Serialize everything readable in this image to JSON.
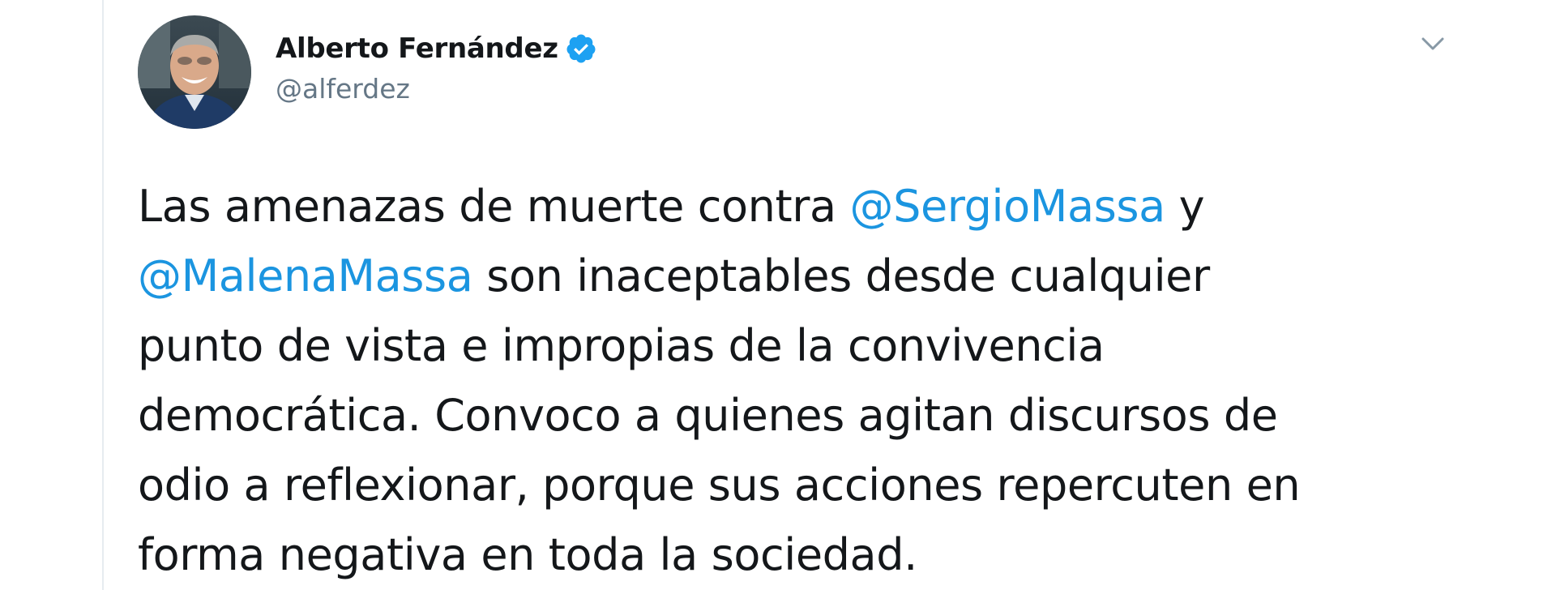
{
  "tweet": {
    "author": {
      "display_name": "Alberto Fernández",
      "handle": "@alferdez",
      "verified": true
    },
    "text_lines": [
      {
        "before": "Las amenazas de muerte contra ",
        "mention": "@SergioMassa",
        "after": " y"
      },
      {
        "before": "",
        "mention": "@MalenaMassa",
        "after": " son inaceptables desde cualquier"
      },
      {
        "before": "punto de vista e impropias de la convivencia",
        "mention": "",
        "after": ""
      },
      {
        "before": "democrática. Convoco a quienes agitan discursos de",
        "mention": "",
        "after": ""
      },
      {
        "before": "odio a reflexionar, porque sus acciones repercuten en",
        "mention": "",
        "after": ""
      },
      {
        "before": "forma negativa en toda la sociedad.",
        "mention": "",
        "after": ""
      }
    ]
  },
  "icons": {
    "verified": "verified-badge-icon",
    "caret": "chevron-down-icon"
  },
  "colors": {
    "mention": "#1b95e0",
    "verified": "#1da1f2",
    "handle": "#657786",
    "text": "#14171a"
  }
}
